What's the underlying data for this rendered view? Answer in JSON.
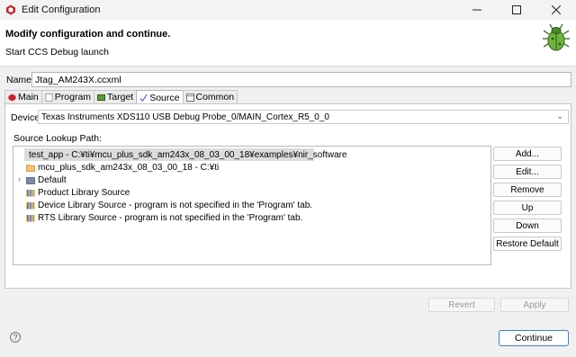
{
  "window": {
    "title": "Edit Configuration"
  },
  "header": {
    "title": "Modify configuration and continue.",
    "subtitle": "Start CCS Debug launch"
  },
  "name_field": {
    "label": "Name:",
    "value": "Jtag_AM243X.ccxml"
  },
  "tabs": [
    {
      "label": "Main",
      "icon": "main-icon"
    },
    {
      "label": "Program",
      "icon": "program-icon"
    },
    {
      "label": "Target",
      "icon": "target-icon"
    },
    {
      "label": "Source",
      "icon": "source-icon",
      "active": true
    },
    {
      "label": "Common",
      "icon": "common-icon"
    }
  ],
  "device": {
    "label": "Device",
    "value": "Texas Instruments XDS110 USB Debug Probe_0/MAIN_Cortex_R5_0_0"
  },
  "source_lookup": {
    "label": "Source Lookup Path:",
    "items": [
      {
        "text": "test_app - C:¥ti¥mcu_plus_sdk_am243x_08_03_00_18¥examples¥nir_software",
        "icon": "folder-icon",
        "selected": true
      },
      {
        "text": "mcu_plus_sdk_am243x_08_03_00_18 - C:¥ti",
        "icon": "folder-icon"
      },
      {
        "text": "Default",
        "icon": "default-icon",
        "expandable": true
      },
      {
        "text": "Product Library Source",
        "icon": "library-icon"
      },
      {
        "text": "Device Library Source - program is not specified in the 'Program' tab.",
        "icon": "library-icon"
      },
      {
        "text": "RTS Library Source - program is not specified in the 'Program' tab.",
        "icon": "library-icon"
      }
    ]
  },
  "buttons": {
    "add": "Add...",
    "edit": "Edit...",
    "remove": "Remove",
    "up": "Up",
    "down": "Down",
    "restore": "Restore Default"
  },
  "footer": {
    "revert": "Revert",
    "apply": "Apply",
    "continue": "Continue",
    "help": "?"
  }
}
